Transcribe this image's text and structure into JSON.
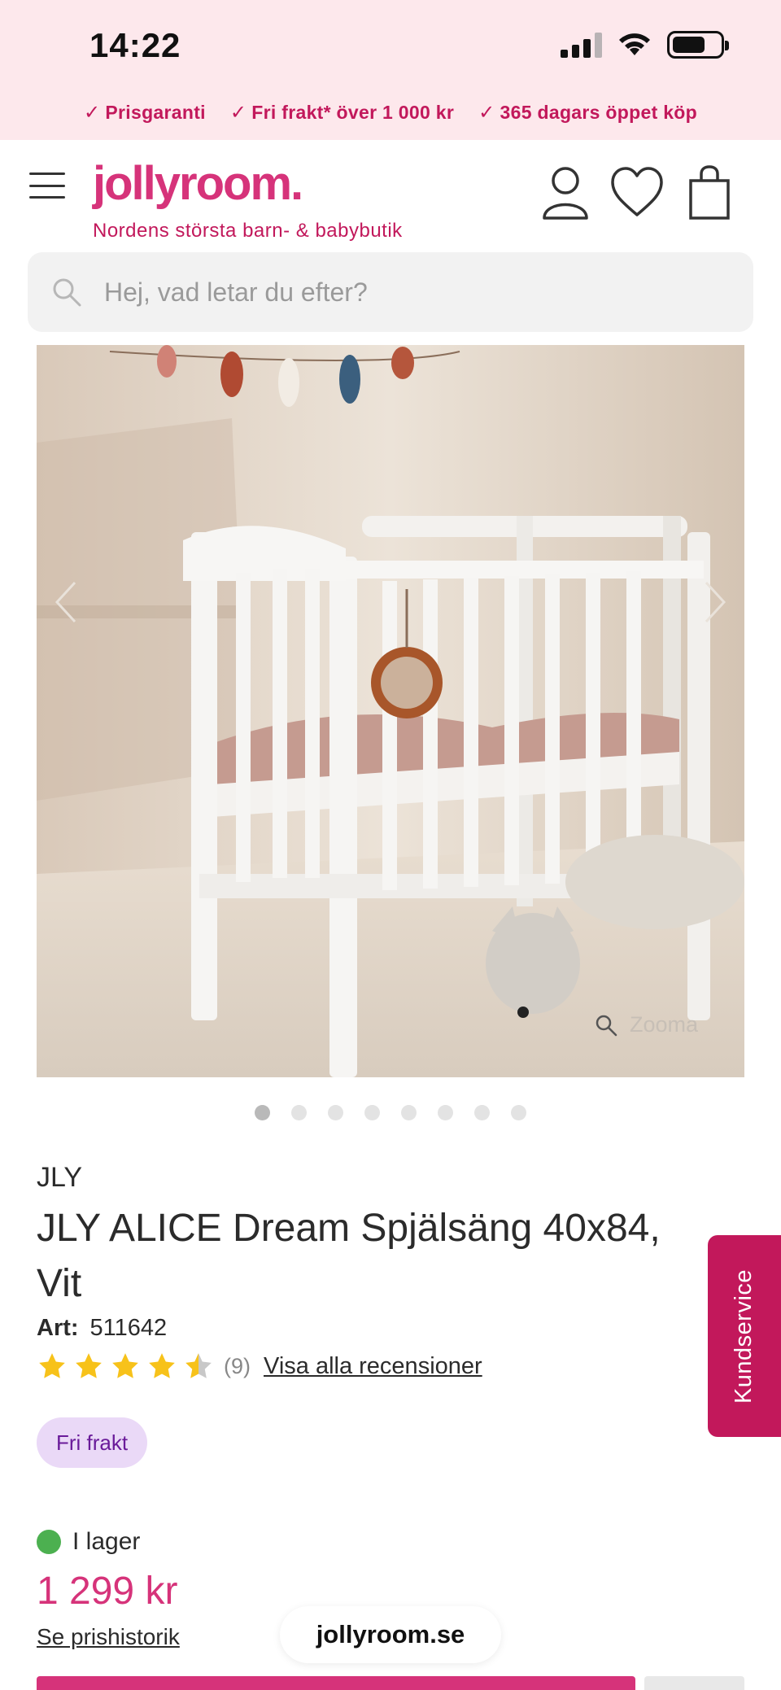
{
  "status_bar": {
    "time": "14:22"
  },
  "usps": [
    {
      "label": "Prisgaranti"
    },
    {
      "label": "Fri frakt* över 1 000 kr"
    },
    {
      "label": "365 dagars öppet köp"
    }
  ],
  "header": {
    "logo_text": "jollyroom.",
    "tagline": "Nordens största barn- & babybutik",
    "icons": [
      "menu-icon",
      "account-icon",
      "heart-icon",
      "cart-icon"
    ]
  },
  "search": {
    "placeholder": "Hej, vad letar du efter?"
  },
  "gallery": {
    "zoom_label": "Zooma",
    "slide_count": 8,
    "active_slide": 1
  },
  "product": {
    "brand": "JLY",
    "title": "JLY ALICE Dream Spjälsäng 40x84, Vit",
    "art_label": "Art:",
    "art_number": "511642",
    "rating_value": 4.5,
    "review_count": "(9)",
    "reviews_link": "Visa alla recensioner",
    "badge": "Fri frakt",
    "stock_status": "I lager",
    "price": "1 299 kr",
    "price_history_link": "Se prishistorik"
  },
  "browser": {
    "domain": "jollyroom.se"
  },
  "kundservice": {
    "label": "Kundservice"
  },
  "colors": {
    "brand_pink": "#d6337a",
    "accent_magenta": "#c2185b",
    "usp_background": "#fde8ec",
    "badge_background": "#ead9f7",
    "in_stock_green": "#4cb050",
    "star_yellow": "#f7c21a"
  }
}
